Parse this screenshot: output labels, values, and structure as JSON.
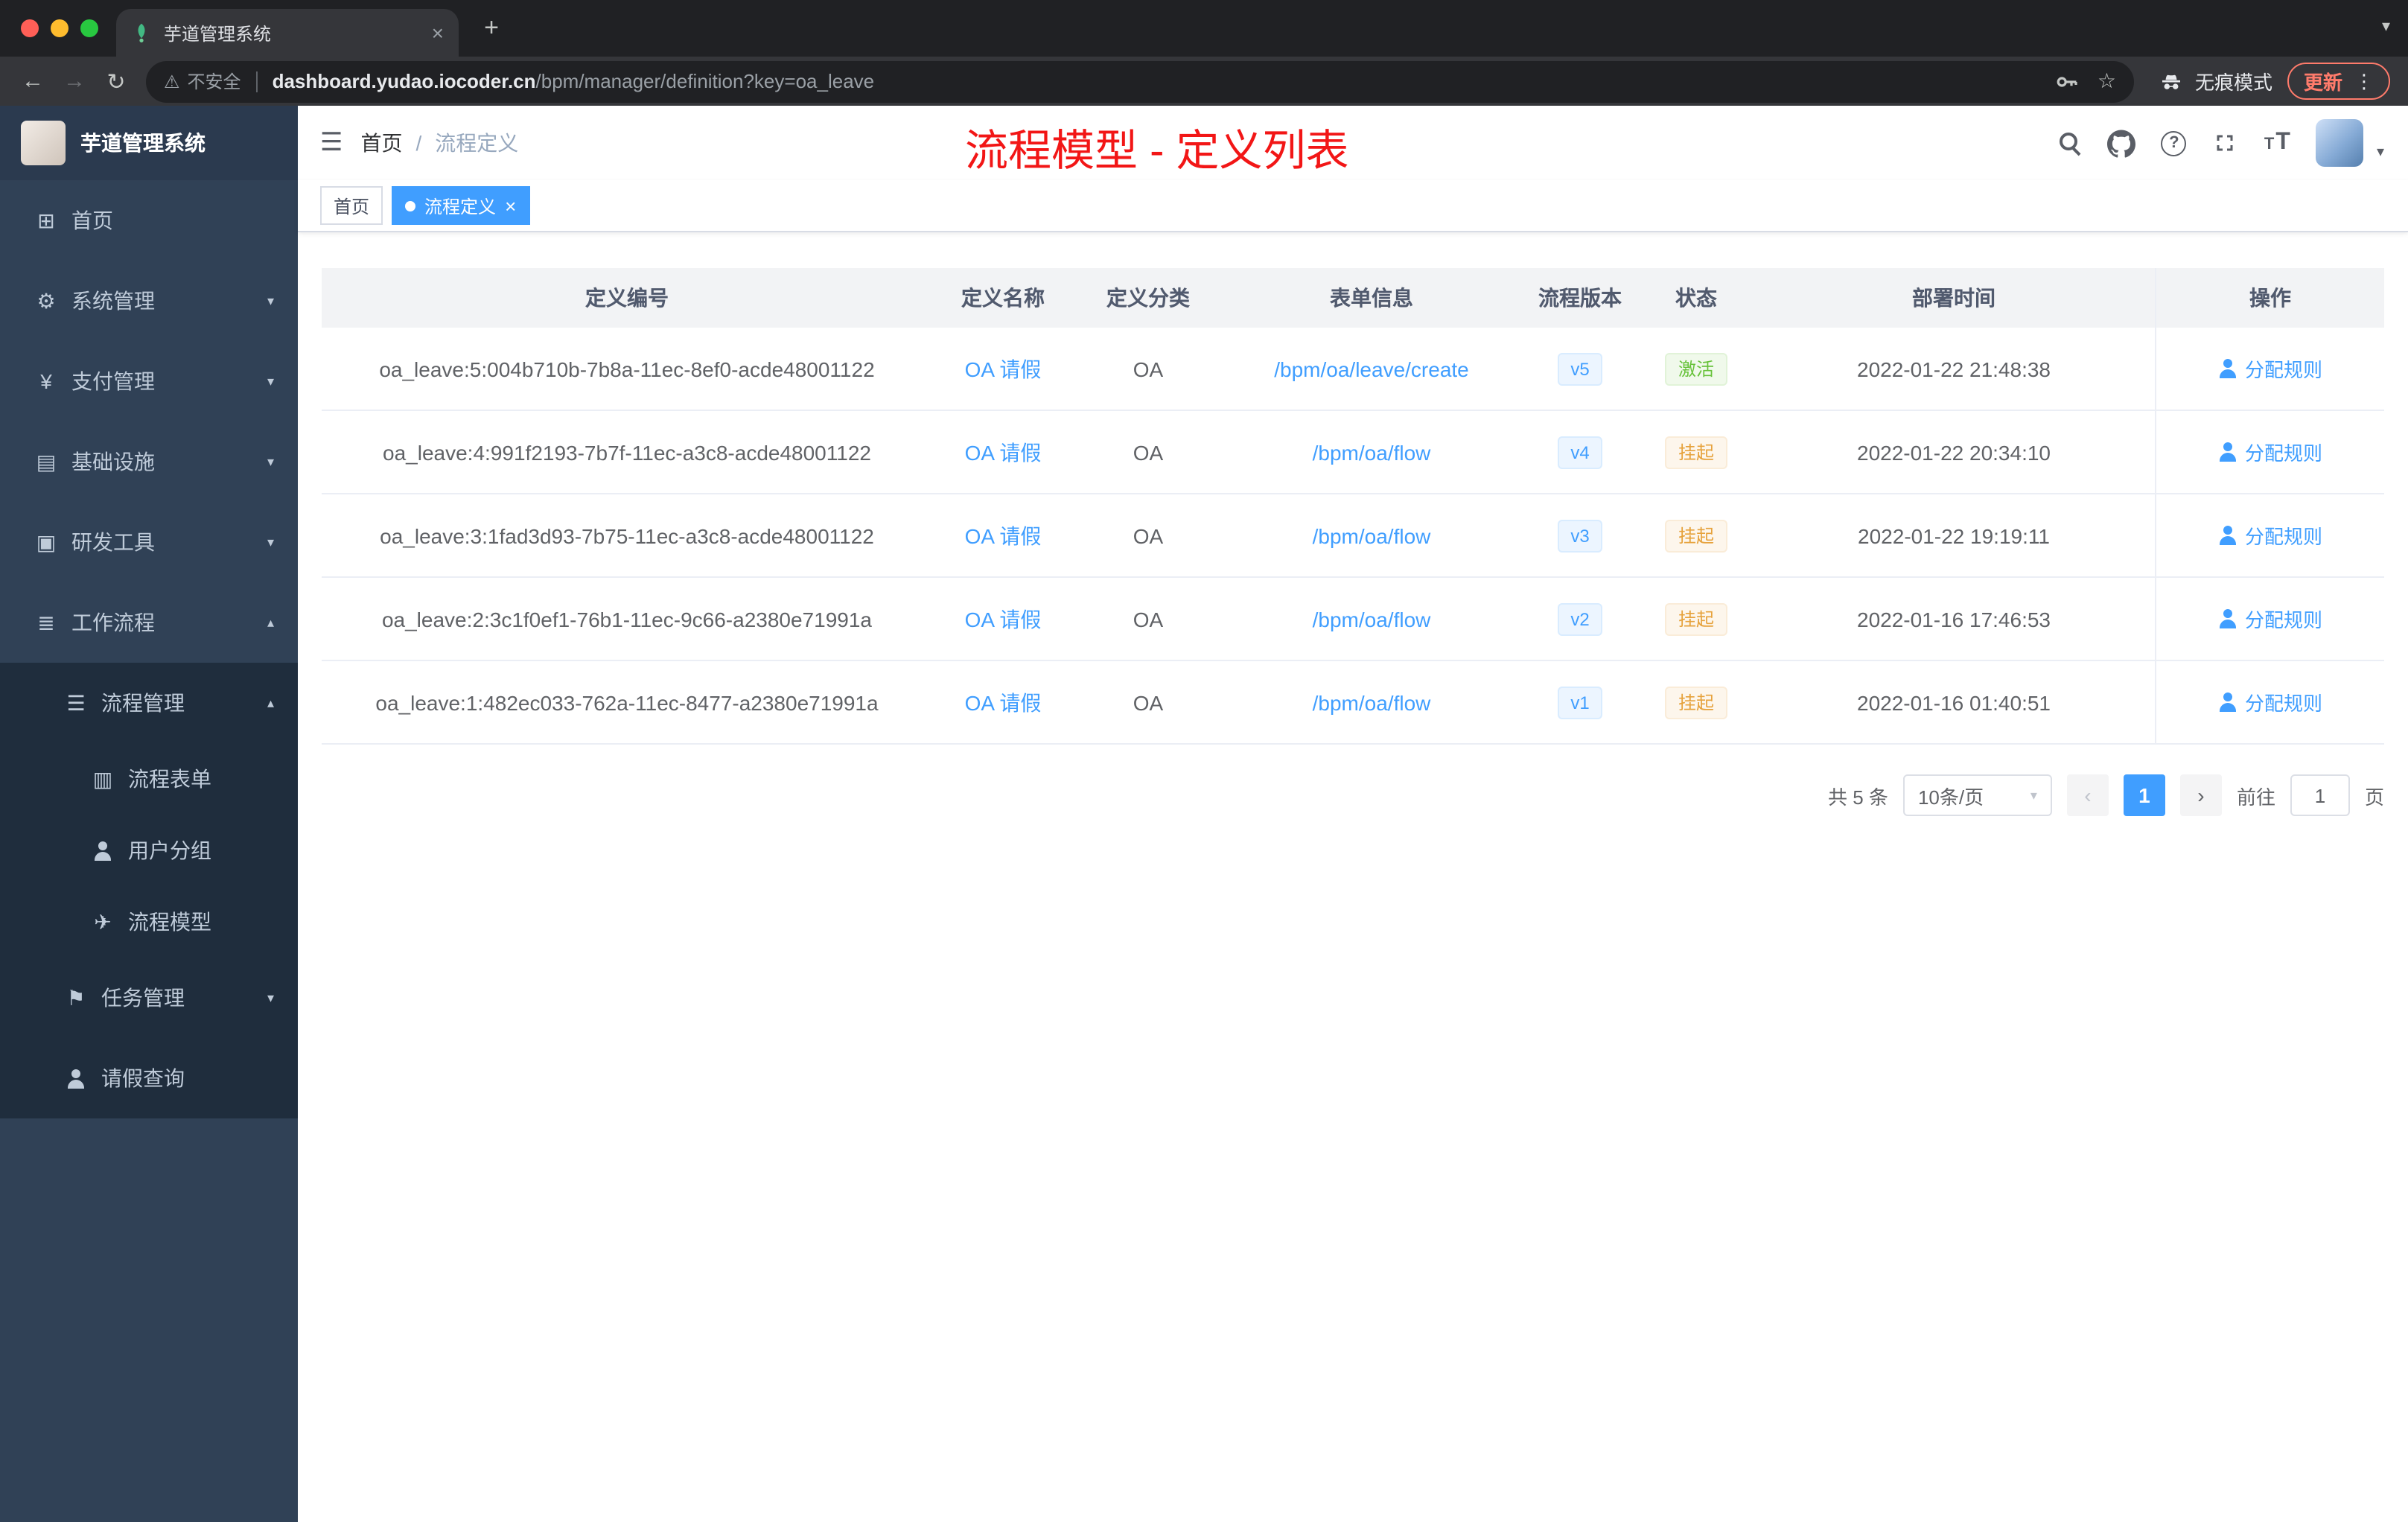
{
  "icons": {
    "close": "×",
    "plus": "+",
    "chevron_down": "▾",
    "chevron_up": "▴",
    "back": "←",
    "forward": "→",
    "reload": "↻",
    "warning": "⚠",
    "star": "☆",
    "kebab": "⋮",
    "home": "⊞",
    "gear": "⚙",
    "yen": "¥",
    "infra": "▤",
    "dev": "▣",
    "workflow": "≣",
    "list": "☰",
    "form": "▥",
    "send": "✈",
    "flag": "⚑",
    "hamburger": "☰",
    "question": "?",
    "size_small": "T",
    "size_big": "T",
    "prev": "‹",
    "next": "›",
    "breadcrumb_sep": "/"
  },
  "browser": {
    "tab_title": "芋道管理系统",
    "security_label": "不安全",
    "url_host": "dashboard.yudao.iocoder.cn",
    "url_path": "/bpm/manager/definition?key=oa_leave",
    "incognito_label": "无痕模式",
    "update_label": "更新"
  },
  "sidebar": {
    "logo_title": "芋道管理系统",
    "items": [
      {
        "label": "首页"
      },
      {
        "label": "系统管理"
      },
      {
        "label": "支付管理"
      },
      {
        "label": "基础设施"
      },
      {
        "label": "研发工具"
      },
      {
        "label": "工作流程"
      },
      {
        "label": "流程管理"
      },
      {
        "label": "流程表单"
      },
      {
        "label": "用户分组"
      },
      {
        "label": "流程模型"
      },
      {
        "label": "任务管理"
      },
      {
        "label": "请假查询"
      }
    ]
  },
  "header": {
    "breadcrumb_home": "首页",
    "breadcrumb_current": "流程定义",
    "annotation": "流程模型 - 定义列表"
  },
  "tags": {
    "home": "首页",
    "active": "流程定义"
  },
  "table": {
    "columns": [
      "定义编号",
      "定义名称",
      "定义分类",
      "表单信息",
      "流程版本",
      "状态",
      "部署时间",
      "操作"
    ],
    "action_label": "分配规则",
    "rows": [
      {
        "id": "oa_leave:5:004b710b-7b8a-11ec-8ef0-acde48001122",
        "name": "OA 请假",
        "category": "OA",
        "form": "/bpm/oa/leave/create",
        "version": "v5",
        "status": "激活",
        "status_type": "success",
        "time": "2022-01-22 21:48:38"
      },
      {
        "id": "oa_leave:4:991f2193-7b7f-11ec-a3c8-acde48001122",
        "name": "OA 请假",
        "category": "OA",
        "form": "/bpm/oa/flow",
        "version": "v4",
        "status": "挂起",
        "status_type": "warning",
        "time": "2022-01-22 20:34:10"
      },
      {
        "id": "oa_leave:3:1fad3d93-7b75-11ec-a3c8-acde48001122",
        "name": "OA 请假",
        "category": "OA",
        "form": "/bpm/oa/flow",
        "version": "v3",
        "status": "挂起",
        "status_type": "warning",
        "time": "2022-01-22 19:19:11"
      },
      {
        "id": "oa_leave:2:3c1f0ef1-76b1-11ec-9c66-a2380e71991a",
        "name": "OA 请假",
        "category": "OA",
        "form": "/bpm/oa/flow",
        "version": "v2",
        "status": "挂起",
        "status_type": "warning",
        "time": "2022-01-16 17:46:53"
      },
      {
        "id": "oa_leave:1:482ec033-762a-11ec-8477-a2380e71991a",
        "name": "OA 请假",
        "category": "OA",
        "form": "/bpm/oa/flow",
        "version": "v1",
        "status": "挂起",
        "status_type": "warning",
        "time": "2022-01-16 01:40:51"
      }
    ]
  },
  "pagination": {
    "total": "共 5 条",
    "page_size": "10条/页",
    "current_page": "1",
    "goto_prefix": "前往",
    "goto_value": "1",
    "goto_suffix": "页"
  }
}
